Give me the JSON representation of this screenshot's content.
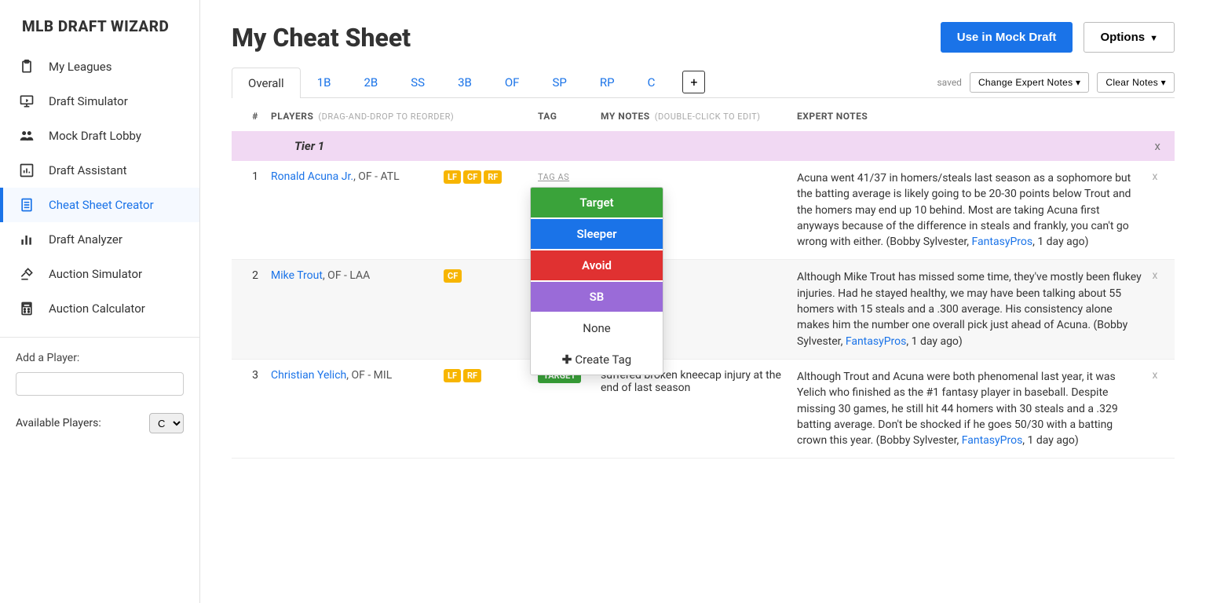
{
  "brand": "MLB DRAFT WIZARD",
  "nav": [
    {
      "label": "My Leagues",
      "icon": "clipboard"
    },
    {
      "label": "Draft Simulator",
      "icon": "monitor"
    },
    {
      "label": "Mock Draft Lobby",
      "icon": "users"
    },
    {
      "label": "Draft Assistant",
      "icon": "bar-chart"
    },
    {
      "label": "Cheat Sheet Creator",
      "icon": "sheet",
      "active": true
    },
    {
      "label": "Draft Analyzer",
      "icon": "analytics"
    },
    {
      "label": "Auction Simulator",
      "icon": "gavel"
    },
    {
      "label": "Auction Calculator",
      "icon": "calculator"
    }
  ],
  "sidebar_bottom": {
    "add_player_label": "Add a Player:",
    "available_players_label": "Available Players:",
    "available_players_value": "C"
  },
  "header": {
    "title": "My Cheat Sheet",
    "primary_btn": "Use in Mock Draft",
    "options_btn": "Options"
  },
  "tabs": {
    "items": [
      "Overall",
      "1B",
      "2B",
      "SS",
      "3B",
      "OF",
      "SP",
      "RP",
      "C"
    ],
    "active_index": 0,
    "add_label": "+",
    "saved_label": "saved",
    "change_notes_btn": "Change Expert Notes",
    "clear_notes_btn": "Clear Notes"
  },
  "columns": {
    "num": "#",
    "players": "PLAYERS",
    "players_hint": "(DRAG-AND-DROP TO REORDER)",
    "tag": "TAG",
    "my_notes": "MY NOTES",
    "my_notes_hint": "(DOUBLE-CLICK TO EDIT)",
    "expert": "EXPERT NOTES"
  },
  "tier": {
    "label": "Tier 1",
    "close": "x"
  },
  "tag_menu": {
    "tag_as": "TAG AS",
    "target": "Target",
    "sleeper": "Sleeper",
    "avoid": "Avoid",
    "sb": "SB",
    "none": "None",
    "create": "Create Tag"
  },
  "rows": [
    {
      "num": "1",
      "name": "Ronald Acuna Jr.",
      "meta": ", OF - ATL",
      "pos": [
        "LF",
        "CF",
        "RF"
      ],
      "tag": null,
      "note": "",
      "expert": "Acuna went 41/37 in homers/steals last season as a sophomore but the batting average is likely going to be 20-30 points below Trout and the homers may end up 10 behind. Most are taking Acuna first anyways because of the difference in steals and frankly, you can't go wrong with either. (Bobby Sylvester, ",
      "expert_source": "FantasyPros",
      "expert_tail": ", 1 day ago)"
    },
    {
      "num": "2",
      "name": "Mike Trout",
      "meta": ", OF - LAA",
      "pos": [
        "CF"
      ],
      "tag": null,
      "note": "",
      "expert": "Although Mike Trout has missed some time, they've mostly been flukey injuries. Had he stayed healthy, we may have been talking about 55 homers with 15 steals and a .300 average. His consistency alone makes him the number one overall pick just ahead of Acuna. (Bobby Sylvester, ",
      "expert_source": "FantasyPros",
      "expert_tail": ", 1 day ago)"
    },
    {
      "num": "3",
      "name": "Christian Yelich",
      "meta": ", OF - MIL",
      "pos": [
        "LF",
        "RF"
      ],
      "tag": "TARGET",
      "note": "suffered broken kneecap injury at the end of last season",
      "expert": "Although Trout and Acuna were both phenomenal last year, it was Yelich who finished as the #1 fantasy player in baseball. Despite missing 30 games, he still hit 44 homers with 30 steals and a .329 batting average. Don't be shocked if he goes 50/30 with a batting crown this year. (Bobby Sylvester, ",
      "expert_source": "FantasyPros",
      "expert_tail": ", 1 day ago)"
    }
  ]
}
